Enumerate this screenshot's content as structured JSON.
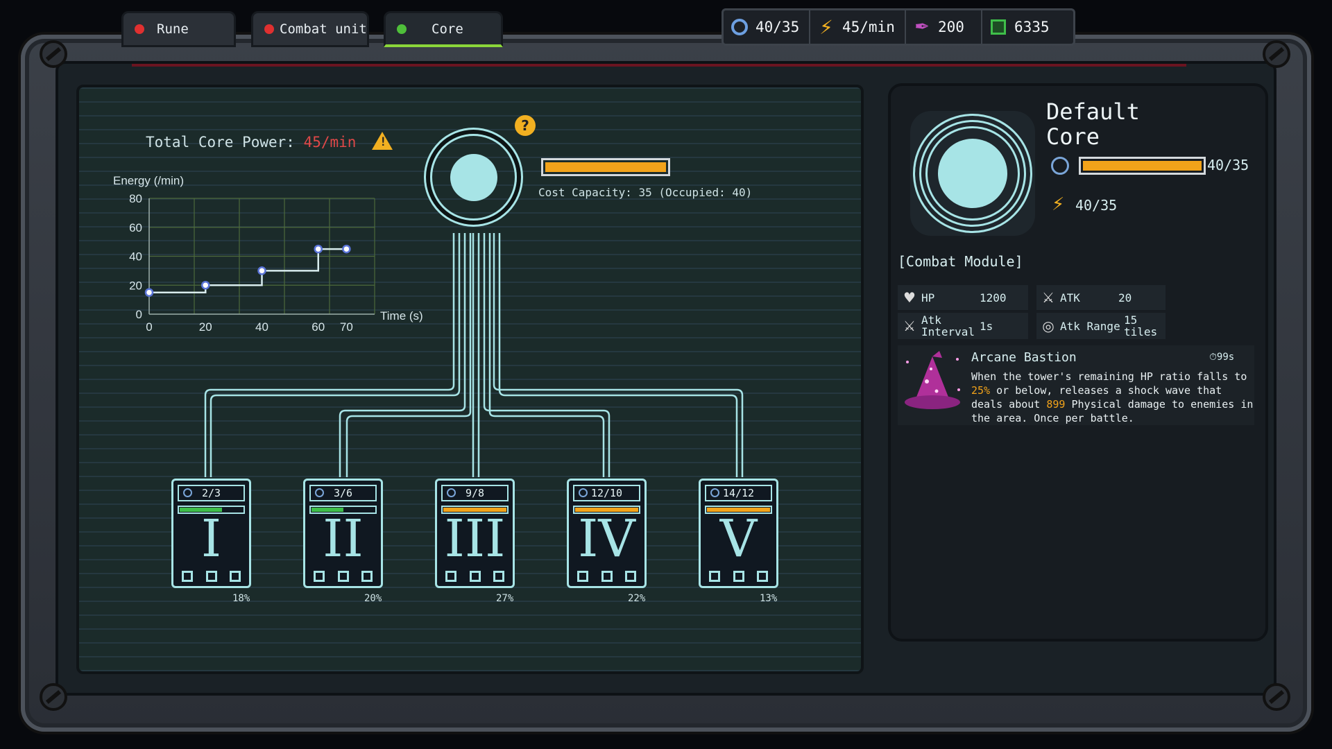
{
  "tabs": [
    {
      "label": "Rune",
      "led": "#e03030",
      "active": false
    },
    {
      "label": "Combat unit",
      "led": "#e03030",
      "active": false
    },
    {
      "label": "Core",
      "led": "#4fbf3a",
      "active": true
    }
  ],
  "resources": [
    {
      "icon": "gear-icon",
      "value": "40/35"
    },
    {
      "icon": "lightning-icon",
      "value": "45/min"
    },
    {
      "icon": "feather-icon",
      "value": "200"
    },
    {
      "icon": "chip-icon",
      "value": "6335"
    }
  ],
  "core_power": {
    "label": "Total Core Power:",
    "value": "45/min"
  },
  "chart_data": {
    "type": "line",
    "ylabel": "Energy (/min)",
    "xlabel": "Time (s)",
    "x_ticks": [
      "0",
      "20",
      "40",
      "60",
      "70"
    ],
    "y_ticks": [
      "0",
      "20",
      "40",
      "60",
      "80"
    ],
    "ylim": [
      0,
      80
    ],
    "step": true,
    "points": [
      [
        0,
        15
      ],
      [
        20,
        20
      ],
      [
        40,
        30
      ],
      [
        60,
        45
      ],
      [
        70,
        45
      ]
    ],
    "grid": true
  },
  "capacity": {
    "text": "Cost Capacity: 35  (Occupied: 40)",
    "fill": 1.0
  },
  "tiers": [
    {
      "numeral": "I",
      "count": "2/3",
      "fill": 0.67,
      "bar_color": "#3fbf4a",
      "pct": "18%"
    },
    {
      "numeral": "II",
      "count": "3/6",
      "fill": 0.5,
      "bar_color": "#3fbf4a",
      "pct": "20%"
    },
    {
      "numeral": "III",
      "count": "9/8",
      "fill": 1.0,
      "bar_color": "#f2a31a",
      "pct": "27%"
    },
    {
      "numeral": "IV",
      "count": "12/10",
      "fill": 1.0,
      "bar_color": "#f2a31a",
      "pct": "22%"
    },
    {
      "numeral": "V",
      "count": "14/12",
      "fill": 1.0,
      "bar_color": "#f2a31a",
      "pct": "13%"
    }
  ],
  "core_detail": {
    "title": "Default Core",
    "capacity_value": "40/35",
    "capacity_fill": 1.0,
    "energy_value": "40/35",
    "module_label": "[Combat Module]",
    "stats": {
      "hp_label": "HP",
      "hp_value": "1200",
      "atk_label": "ATK",
      "atk_value": "20",
      "interval_label": "Atk Interval",
      "interval_value": "1s",
      "range_label": "Atk Range",
      "range_value": "15 tiles"
    },
    "ability": {
      "name": "Arcane Bastion",
      "cooldown": "99s",
      "desc_1": "When the tower's remaining HP ratio falls to ",
      "desc_hl1": "25%",
      "desc_2": " or below, releases a shock wave that deals about ",
      "desc_hl2": "899",
      "desc_3": " Physical damage to enemies in the area. Once per battle."
    }
  },
  "colors": {
    "accent": "#a7e4e6",
    "warning": "#f2a31a",
    "danger": "#e04848"
  }
}
